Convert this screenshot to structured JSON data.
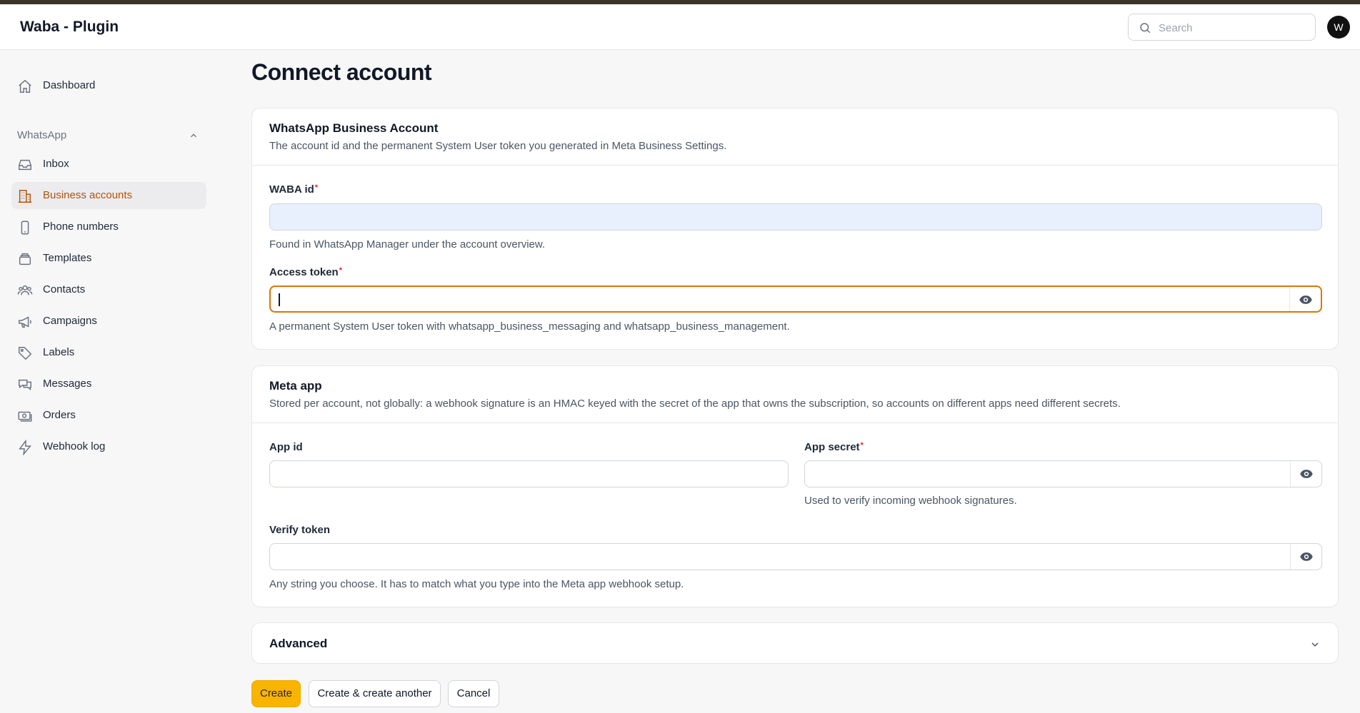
{
  "app": {
    "title": "Waba - Plugin"
  },
  "header": {
    "search_placeholder": "Search",
    "avatar_initial": "W"
  },
  "sidebar": {
    "dashboard": "Dashboard",
    "group_label": "WhatsApp",
    "items": [
      {
        "label": "Inbox",
        "icon": "inbox-icon"
      },
      {
        "label": "Business accounts",
        "icon": "building-icon",
        "active": true
      },
      {
        "label": "Phone numbers",
        "icon": "phone-icon"
      },
      {
        "label": "Templates",
        "icon": "stack-icon"
      },
      {
        "label": "Contacts",
        "icon": "users-icon"
      },
      {
        "label": "Campaigns",
        "icon": "megaphone-icon"
      },
      {
        "label": "Labels",
        "icon": "tag-icon"
      },
      {
        "label": "Messages",
        "icon": "chat-icon"
      },
      {
        "label": "Orders",
        "icon": "cash-icon"
      },
      {
        "label": "Webhook log",
        "icon": "bolt-icon"
      }
    ]
  },
  "page": {
    "title": "Connect account"
  },
  "waba_section": {
    "title": "WhatsApp Business Account",
    "description": "The account id and the permanent System User token you generated in Meta Business Settings.",
    "waba_id": {
      "label": "WABA id",
      "required": "*",
      "value": "",
      "hint": "Found in WhatsApp Manager under the account overview."
    },
    "access_token": {
      "label": "Access token",
      "required": "*",
      "value": "",
      "hint": "A permanent System User token with whatsapp_business_messaging and whatsapp_business_management."
    }
  },
  "meta_section": {
    "title": "Meta app",
    "description": "Stored per account, not globally: a webhook signature is an HMAC keyed with the secret of the app that owns the subscription, so accounts on different apps need different secrets.",
    "app_id": {
      "label": "App id",
      "value": ""
    },
    "app_secret": {
      "label": "App secret",
      "required": "*",
      "value": "",
      "hint": "Used to verify incoming webhook signatures."
    },
    "verify_token": {
      "label": "Verify token",
      "value": "",
      "hint": "Any string you choose. It has to match what you type into the Meta app webhook setup."
    }
  },
  "advanced": {
    "title": "Advanced"
  },
  "actions": {
    "create": "Create",
    "create_another": "Create & create another",
    "cancel": "Cancel"
  },
  "colors": {
    "accent": "#f9b400",
    "active_nav_text": "#b45309",
    "focus_border": "#d97706",
    "required": "#dc2626"
  }
}
